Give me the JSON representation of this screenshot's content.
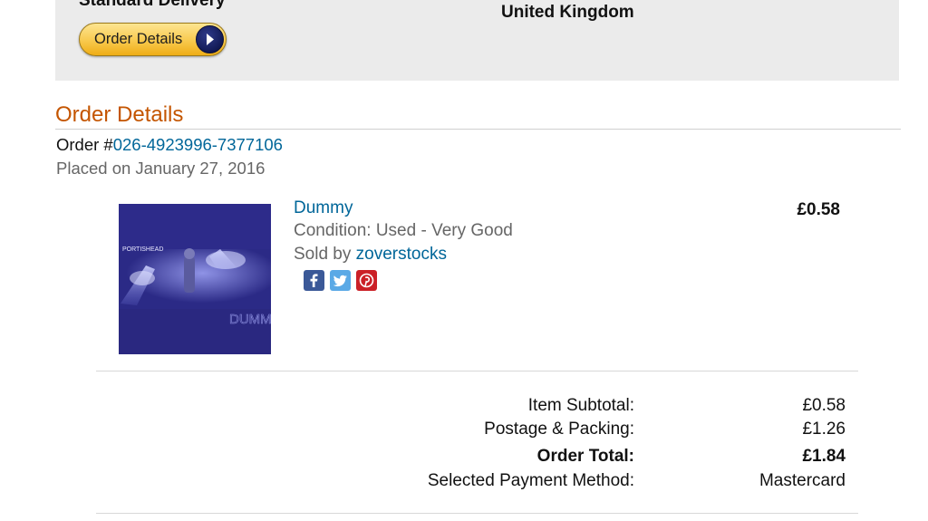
{
  "shipping": {
    "method": "Standard Delivery",
    "country": "United Kingdom",
    "order_details_button": "Order Details"
  },
  "order": {
    "section_title": "Order Details",
    "order_prefix": "Order #",
    "order_number": "026-4923996-7377106",
    "placed_on": "Placed on January 27, 2016"
  },
  "item": {
    "title": "Dummy",
    "condition": "Condition: Used - Very Good",
    "sold_by_prefix": "Sold by ",
    "seller": "zoverstocks",
    "price": "£0.58",
    "album_art_text": "PORTISHEAD",
    "album_art_title": "DUMMY",
    "share_icons": [
      "facebook-icon",
      "twitter-icon",
      "pinterest-icon"
    ]
  },
  "summary": {
    "subtotal_label": "Item Subtotal:",
    "subtotal_value": "£0.58",
    "postage_label": "Postage & Packing:",
    "postage_value": "£1.26",
    "total_label": "Order Total:",
    "total_value": "£1.84",
    "payment_label": "Selected Payment Method:",
    "payment_value": "Mastercard"
  },
  "colors": {
    "section_title": "#c45500",
    "link": "#006699",
    "button_gold": "#f8c94d"
  }
}
